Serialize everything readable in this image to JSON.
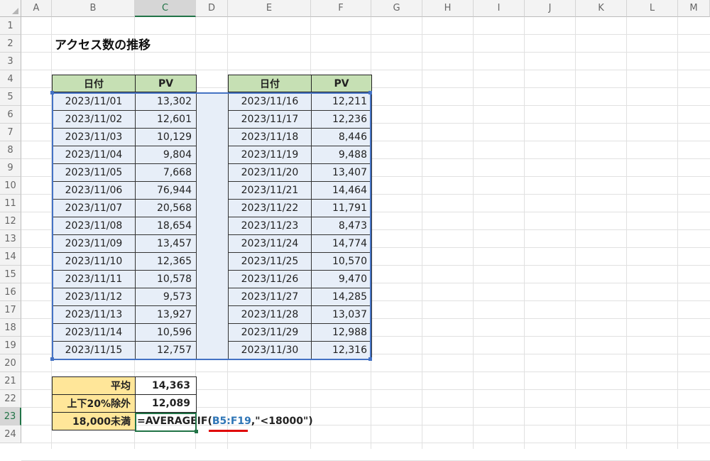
{
  "columns": [
    "A",
    "B",
    "C",
    "D",
    "E",
    "F",
    "G",
    "H",
    "I",
    "J",
    "K",
    "L",
    "M"
  ],
  "rows": [
    "1",
    "2",
    "3",
    "4",
    "5",
    "6",
    "7",
    "8",
    "9",
    "10",
    "11",
    "12",
    "13",
    "14",
    "15",
    "16",
    "17",
    "18",
    "19",
    "20",
    "21",
    "22",
    "23",
    "24"
  ],
  "title": "アクセス数の推移",
  "table_headers": {
    "date": "日付",
    "pv": "PV"
  },
  "left_table": [
    {
      "date": "2023/11/01",
      "pv": "13,302"
    },
    {
      "date": "2023/11/02",
      "pv": "12,601"
    },
    {
      "date": "2023/11/03",
      "pv": "10,129"
    },
    {
      "date": "2023/11/04",
      "pv": "9,804"
    },
    {
      "date": "2023/11/05",
      "pv": "7,668"
    },
    {
      "date": "2023/11/06",
      "pv": "76,944"
    },
    {
      "date": "2023/11/07",
      "pv": "20,568"
    },
    {
      "date": "2023/11/08",
      "pv": "18,654"
    },
    {
      "date": "2023/11/09",
      "pv": "13,457"
    },
    {
      "date": "2023/11/10",
      "pv": "12,365"
    },
    {
      "date": "2023/11/11",
      "pv": "10,578"
    },
    {
      "date": "2023/11/12",
      "pv": "9,573"
    },
    {
      "date": "2023/11/13",
      "pv": "13,927"
    },
    {
      "date": "2023/11/14",
      "pv": "10,596"
    },
    {
      "date": "2023/11/15",
      "pv": "12,757"
    }
  ],
  "right_table": [
    {
      "date": "2023/11/16",
      "pv": "12,211"
    },
    {
      "date": "2023/11/17",
      "pv": "12,236"
    },
    {
      "date": "2023/11/18",
      "pv": "8,446"
    },
    {
      "date": "2023/11/19",
      "pv": "9,488"
    },
    {
      "date": "2023/11/20",
      "pv": "13,407"
    },
    {
      "date": "2023/11/21",
      "pv": "14,464"
    },
    {
      "date": "2023/11/22",
      "pv": "11,791"
    },
    {
      "date": "2023/11/23",
      "pv": "8,473"
    },
    {
      "date": "2023/11/24",
      "pv": "14,774"
    },
    {
      "date": "2023/11/25",
      "pv": "10,570"
    },
    {
      "date": "2023/11/26",
      "pv": "9,470"
    },
    {
      "date": "2023/11/27",
      "pv": "14,285"
    },
    {
      "date": "2023/11/28",
      "pv": "13,037"
    },
    {
      "date": "2023/11/29",
      "pv": "12,988"
    },
    {
      "date": "2023/11/30",
      "pv": "12,316"
    }
  ],
  "summary": [
    {
      "label": "平均",
      "value": "14,363"
    },
    {
      "label": "上下20%除外",
      "value": "12,089"
    },
    {
      "label": "18,000未満",
      "value": ""
    }
  ],
  "formula": {
    "prefix": "=AVERAGEIF(",
    "ref": "B5:F19",
    "suffix": ",\"<18000\")"
  },
  "active_cell": "C23",
  "colors": {
    "header_fill": "#c6e0b4",
    "label_fill": "#ffe699",
    "selection": "#4472c4",
    "highlight_fill": "#e7eef8",
    "underline": "#e00000"
  }
}
